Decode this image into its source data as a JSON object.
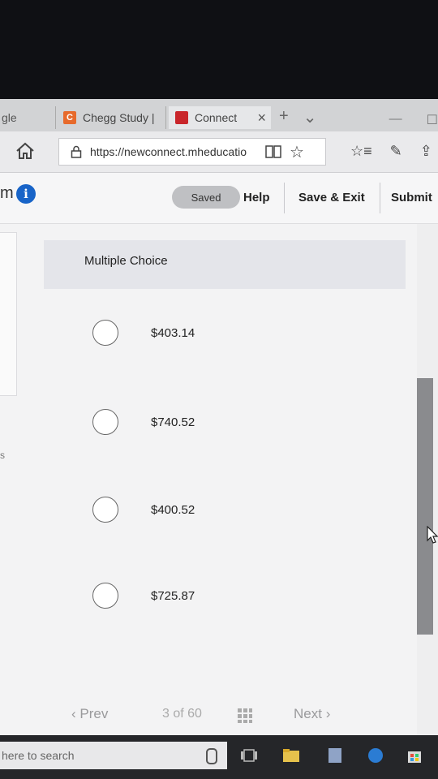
{
  "browser": {
    "tabs": [
      {
        "label": "gle",
        "favicon": ""
      },
      {
        "label": "Chegg Study |",
        "favicon": "C",
        "favicon_color": "#e76a2c"
      },
      {
        "label": "Connect",
        "favicon": "",
        "favicon_color": "#c9262b"
      }
    ],
    "close_tab": "×",
    "new_tab": "+",
    "tab_list": "⌄",
    "url": "https://newconnect.mheducatio",
    "icons": [
      "home-icon",
      "lock-icon",
      "reading-view-icon",
      "favorite-star-icon",
      "favorites-list-icon",
      "pen-icon",
      "share-icon"
    ]
  },
  "header": {
    "fragment": "m",
    "saved": "Saved",
    "help": "Help",
    "save_exit": "Save & Exit",
    "submit": "Submit"
  },
  "question": {
    "side_fragment": "s",
    "type": "Multiple Choice",
    "options": [
      "$403.14",
      "$740.52",
      "$400.52",
      "$725.87"
    ]
  },
  "nav": {
    "prev": "Prev",
    "current": "3",
    "of": "of",
    "total": "60",
    "next": "Next"
  },
  "taskbar": {
    "search_placeholder": "here to search"
  },
  "colors": {
    "info_blue": "#1864c8",
    "saved_pill": "#bfc0c3",
    "scroll_thumb": "#8a8b8e"
  }
}
